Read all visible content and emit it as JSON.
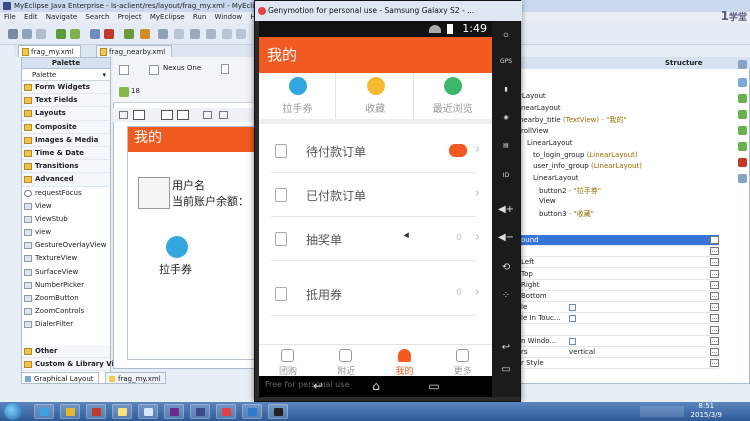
{
  "ide": {
    "title": "MyEclipse Java Enterprise - ls-aclient/res/layout/frag_my.xml - MyEclips",
    "menu": [
      "File",
      "Edit",
      "Navigate",
      "Search",
      "Project",
      "MyEclipse",
      "Run",
      "Window",
      "He"
    ],
    "editor_tabs": [
      "frag_my.xml",
      "frag_nearby.xml"
    ],
    "device_label": "Nexus One",
    "api_label": "18",
    "palette": {
      "header": "Palette",
      "selector": "Palette",
      "items": [
        {
          "label": "Form Widgets",
          "kind": "cat"
        },
        {
          "label": "Text Fields",
          "kind": "cat"
        },
        {
          "label": "Layouts",
          "kind": "cat"
        },
        {
          "label": "Composite",
          "kind": "cat"
        },
        {
          "label": "Images & Media",
          "kind": "cat"
        },
        {
          "label": "Time & Date",
          "kind": "cat"
        },
        {
          "label": "Transitions",
          "kind": "cat"
        },
        {
          "label": "Advanced",
          "kind": "cat"
        },
        {
          "label": "requestFocus",
          "kind": "radio"
        },
        {
          "label": "View",
          "kind": "widget"
        },
        {
          "label": "ViewStub",
          "kind": "widget"
        },
        {
          "label": "view",
          "kind": "widget"
        },
        {
          "label": "GestureOverlayView",
          "kind": "widget"
        },
        {
          "label": "TextureView",
          "kind": "widget"
        },
        {
          "label": "SurfaceView",
          "kind": "widget"
        },
        {
          "label": "NumberPicker",
          "kind": "widget"
        },
        {
          "label": "ZoomButton",
          "kind": "widget"
        },
        {
          "label": "ZoomControls",
          "kind": "widget"
        },
        {
          "label": "DialerFilter",
          "kind": "widget"
        },
        {
          "label": "",
          "kind": "gap"
        },
        {
          "label": "Other",
          "kind": "cat"
        },
        {
          "label": "Custom & Library Vi",
          "kind": "cat"
        }
      ]
    },
    "bottom_tabs": [
      "Graphical Layout",
      "frag_my.xml"
    ],
    "preview": {
      "header": "我的",
      "username": "用户名",
      "balance": "当前账户余额：",
      "quick_label": "拉手券"
    },
    "structure": {
      "header": "Structure",
      "tree": [
        {
          "text": "rLayout",
          "hint": ""
        },
        {
          "text": "inearLayout",
          "hint": ""
        },
        {
          "text": "nearby_title",
          "hint": " (TextView) - \"我的\""
        },
        {
          "text": "rollView",
          "hint": ""
        },
        {
          "text": "LinearLayout",
          "hint": ""
        },
        {
          "text": "to_login_group",
          "hint": " (LinearLayout)"
        },
        {
          "text": "user_info_group",
          "hint": " (LinearLayout)"
        },
        {
          "text": "LinearLayout",
          "hint": ""
        },
        {
          "text": "button2",
          "hint": " - \"拉手券\""
        },
        {
          "text": "View",
          "hint": ""
        },
        {
          "text": "button3",
          "hint": " - \"收藏\""
        }
      ]
    },
    "properties": [
      {
        "name": "ound",
        "value": "",
        "highlight": true,
        "check": false
      },
      {
        "name": "",
        "value": "",
        "highlight": false,
        "check": false
      },
      {
        "name": "Left",
        "value": "",
        "highlight": false,
        "check": false
      },
      {
        "name": "Top",
        "value": "",
        "highlight": false,
        "check": false
      },
      {
        "name": "Right",
        "value": "",
        "highlight": false,
        "check": false
      },
      {
        "name": "Bottom",
        "value": "",
        "highlight": false,
        "check": false
      },
      {
        "name": "le",
        "value": "",
        "highlight": false,
        "check": true
      },
      {
        "name": "le In Touc...",
        "value": "",
        "highlight": false,
        "check": true
      },
      {
        "name": "",
        "value": "",
        "highlight": false,
        "check": false
      },
      {
        "name": "n Windo...",
        "value": "",
        "highlight": false,
        "check": true
      },
      {
        "name": "rs",
        "value": "vertical",
        "highlight": false,
        "check": false
      },
      {
        "name": "r Style",
        "value": "",
        "highlight": false,
        "check": false
      }
    ]
  },
  "emulator": {
    "title": "Genymotion for personal use - Samsung Galaxy S2 - ...",
    "time": "1:49",
    "header": "我的",
    "quick_actions": [
      {
        "label": "拉手券",
        "icon": "coupon-icon",
        "color": "#35a7e0"
      },
      {
        "label": "收藏",
        "icon": "star-icon",
        "color": "#f5b82e"
      },
      {
        "label": "最近浏览",
        "icon": "clock-icon",
        "color": "#3cb66b"
      }
    ],
    "order_rows": [
      {
        "label": "待付款订单",
        "count": "",
        "toggle": true
      },
      {
        "label": "已付款订单",
        "count": "",
        "toggle": false
      },
      {
        "label": "抽奖单",
        "count": "0",
        "toggle": false
      },
      {
        "label": "抵用券",
        "count": "0",
        "toggle": false
      }
    ],
    "bottom_nav": [
      {
        "label": "团购",
        "active": false
      },
      {
        "label": "附近",
        "active": false
      },
      {
        "label": "我的",
        "active": true
      },
      {
        "label": "更多",
        "active": false
      }
    ],
    "side_buttons": [
      "GPS",
      "",
      "",
      "ID",
      "",
      "",
      "",
      "",
      ""
    ],
    "faint_text": "Free for personal use"
  },
  "taskbar": {
    "time": "8:51",
    "date": "2015/3/9"
  },
  "colors": {
    "brand_orange": "#f15b22",
    "selection_blue": "#3875d7"
  }
}
